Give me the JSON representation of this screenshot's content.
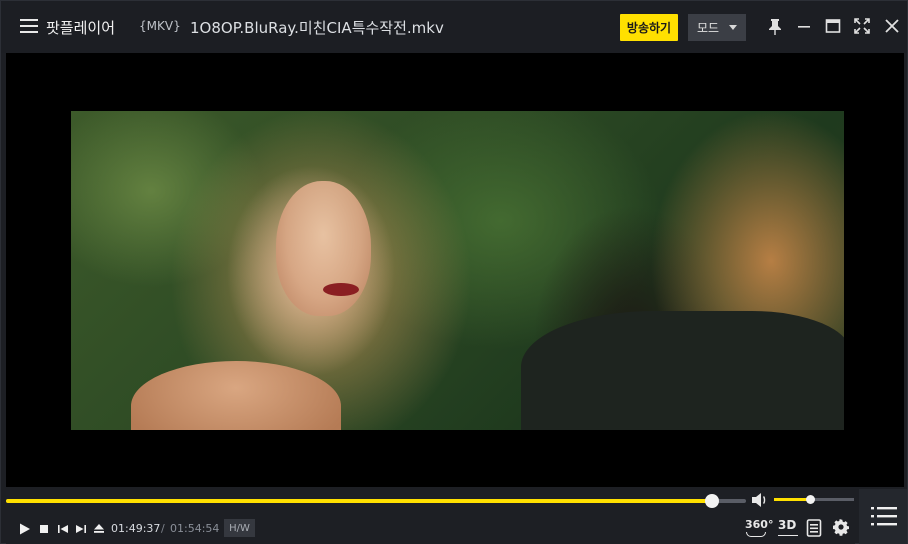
{
  "titlebar": {
    "app_name": "팟플레이어",
    "format_tag": "{MKV}",
    "file_name": "1O8OP.BluRay.미친CIA특수작전.mkv",
    "broadcast_label": "방송하기",
    "mode_label": "모드"
  },
  "window_controls": [
    "pin-icon",
    "minimize-icon",
    "maximize-icon",
    "fullscreen-icon",
    "close-icon"
  ],
  "player": {
    "current_time": "01:49:37",
    "separator": "/",
    "total_time": "01:54:54",
    "hw_label": "H/W",
    "seek_progress": 0.954,
    "volume_level": 0.45,
    "btn_360_label": "360°",
    "btn_3d_label": "3D"
  },
  "colors": {
    "accent": "#ffe000",
    "background": "#1d1f24",
    "video_bg": "#000000"
  }
}
